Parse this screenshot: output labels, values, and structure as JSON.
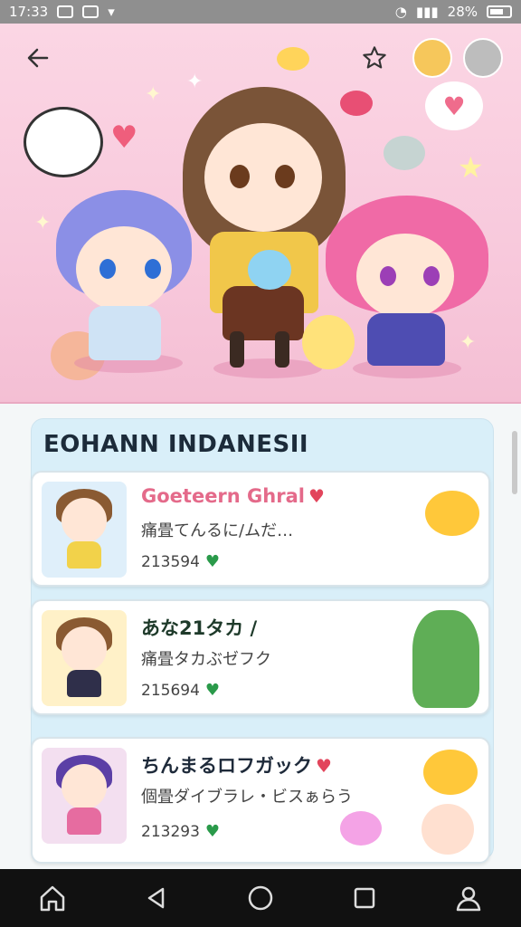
{
  "status_bar": {
    "time": "17:33",
    "battery": "28%"
  },
  "hero": {
    "back_icon": "arrow-left-icon",
    "favorite_icon": "star-outline-icon",
    "speech_symbol": "♥"
  },
  "section": {
    "title": "EOHANN INDANESII"
  },
  "items": [
    {
      "title": "Goeteern Ghral",
      "subtitle": "痛畳てんるに/ムだ…",
      "count": "213594",
      "title_color": "#e46a8a",
      "thumb_bg": "#dfeffa"
    },
    {
      "title": "あな21タカ /",
      "subtitle": "痛畳タカぶゼフク",
      "count": "215694",
      "title_color": "#1e3a2a",
      "thumb_bg": "#fff1c8"
    },
    {
      "title": "ちんまるロフガック",
      "subtitle": "個畳ダイブラレ・ビスぁらう",
      "count": "213293",
      "title_color": "#1e2a3a",
      "thumb_bg": "#f3dff0"
    }
  ],
  "colors": {
    "hero_bg": "#f8c9dc",
    "count_heart": "#2a9a4a",
    "nav_bg": "#111111"
  },
  "nav": [
    "home-icon",
    "back-triangle-icon",
    "circle-home-icon",
    "square-recents-icon",
    "profile-icon"
  ]
}
